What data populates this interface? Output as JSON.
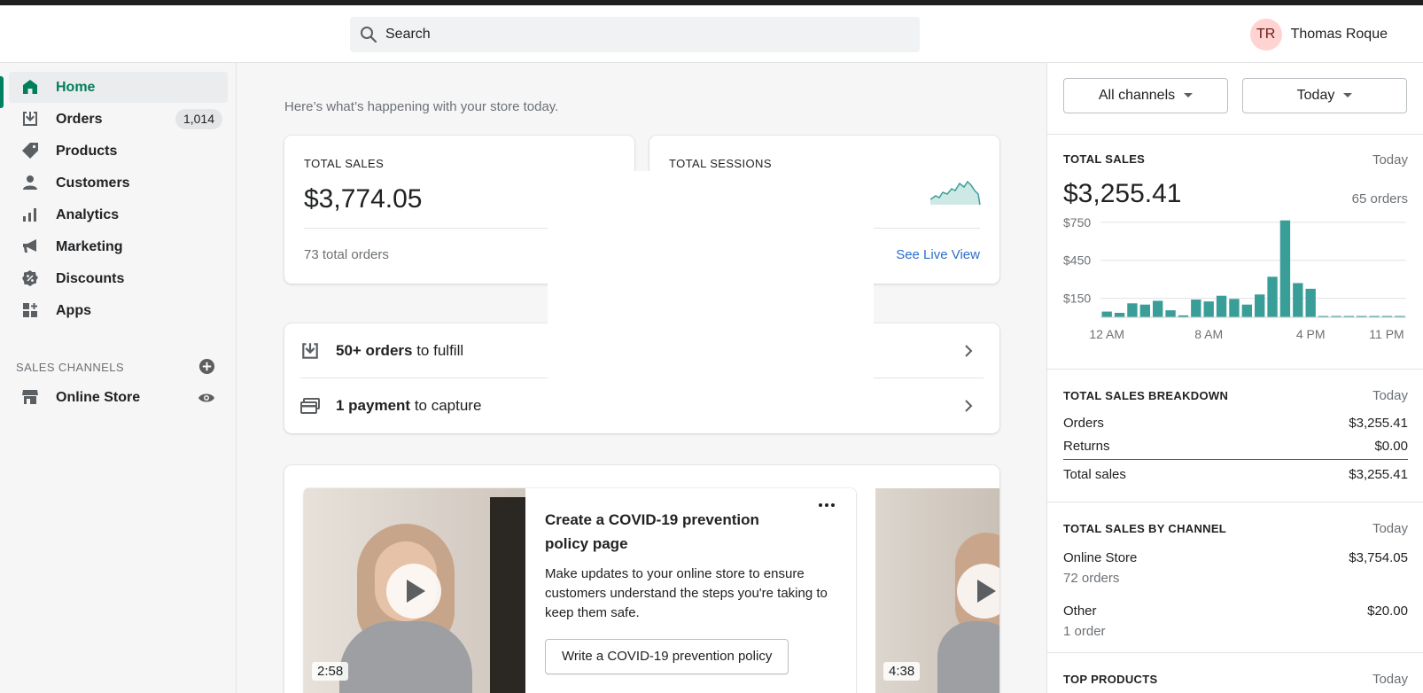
{
  "topbar": {
    "search_placeholder": "Search",
    "user_initials": "TR",
    "user_name": "Thomas Roque"
  },
  "sidebar": {
    "items": [
      {
        "label": "Home",
        "icon": "home-icon",
        "active": true
      },
      {
        "label": "Orders",
        "icon": "orders-icon",
        "badge": "1,014"
      },
      {
        "label": "Products",
        "icon": "tag-icon"
      },
      {
        "label": "Customers",
        "icon": "person-icon"
      },
      {
        "label": "Analytics",
        "icon": "bar-chart-icon"
      },
      {
        "label": "Marketing",
        "icon": "megaphone-icon"
      },
      {
        "label": "Discounts",
        "icon": "discount-icon"
      },
      {
        "label": "Apps",
        "icon": "apps-icon"
      }
    ],
    "sales_channels_title": "SALES CHANNELS",
    "channels": [
      {
        "label": "Online Store",
        "icon": "store-icon"
      }
    ]
  },
  "main": {
    "welcome": "Here’s what’s happening with your store today.",
    "total_sales": {
      "label": "TOTAL SALES",
      "value": "$3,774.05",
      "footer": "73 total orders",
      "link": "V"
    },
    "total_sessions": {
      "label": "TOTAL SESSIONS",
      "link": "See Live View"
    },
    "tasks": [
      {
        "bold": "50+ orders",
        "rest": " to fulfill",
        "icon": "fulfill-icon"
      },
      {
        "bold": "1 payment",
        "rest": " to capture",
        "icon": "payment-icon"
      }
    ],
    "video_card": {
      "title": "Create a COVID-19 prevention policy page",
      "description": "Make updates to your online store to ensure customers understand the steps you're taking to keep them safe.",
      "button": "Write a COVID-19 prevention policy",
      "duration_1": "2:58",
      "duration_2": "4:38"
    }
  },
  "right_panel": {
    "channel_filter": "All channels",
    "date_filter": "Today",
    "total_sales": {
      "title": "TOTAL SALES",
      "when": "Today",
      "value": "$3,255.41",
      "orders": "65 orders"
    },
    "breakdown": {
      "title": "TOTAL SALES BREAKDOWN",
      "when": "Today",
      "rows": [
        {
          "label": "Orders",
          "value": "$3,255.41"
        },
        {
          "label": "Returns",
          "value": "$0.00"
        },
        {
          "label": "Total sales",
          "value": "$3,255.41"
        }
      ]
    },
    "by_channel": {
      "title": "TOTAL SALES BY CHANNEL",
      "when": "Today",
      "rows": [
        {
          "label": "Online Store",
          "value": "$3,754.05",
          "sub": "72 orders"
        },
        {
          "label": "Other",
          "value": "$20.00",
          "sub": "1 order"
        }
      ]
    },
    "top_products": {
      "title": "TOP PRODUCTS",
      "when": "Today"
    }
  },
  "colors": {
    "accent": "#008060",
    "bar": "#3a9e98",
    "link": "#2c6ecb"
  },
  "chart_data": {
    "type": "bar",
    "categories": [
      "12 AM",
      "1 AM",
      "2 AM",
      "3 AM",
      "4 AM",
      "5 AM",
      "6 AM",
      "7 AM",
      "8 AM",
      "9 AM",
      "10 AM",
      "11 AM",
      "12 PM",
      "1 PM",
      "2 PM",
      "3 PM",
      "4 PM",
      "5 PM",
      "6 PM",
      "7 PM",
      "8 PM",
      "9 PM",
      "10 PM",
      "11 PM"
    ],
    "values": [
      45,
      35,
      110,
      100,
      130,
      55,
      15,
      140,
      125,
      170,
      145,
      100,
      180,
      320,
      765,
      270,
      225,
      10,
      10,
      10,
      10,
      10,
      10,
      10
    ],
    "yticks": [
      "$750",
      "$450",
      "$150"
    ],
    "ytick_values": [
      750,
      450,
      150
    ],
    "xticks": [
      "12 AM",
      "8 AM",
      "4 PM",
      "11 PM"
    ],
    "ylim": [
      0,
      770
    ],
    "grid": true
  }
}
